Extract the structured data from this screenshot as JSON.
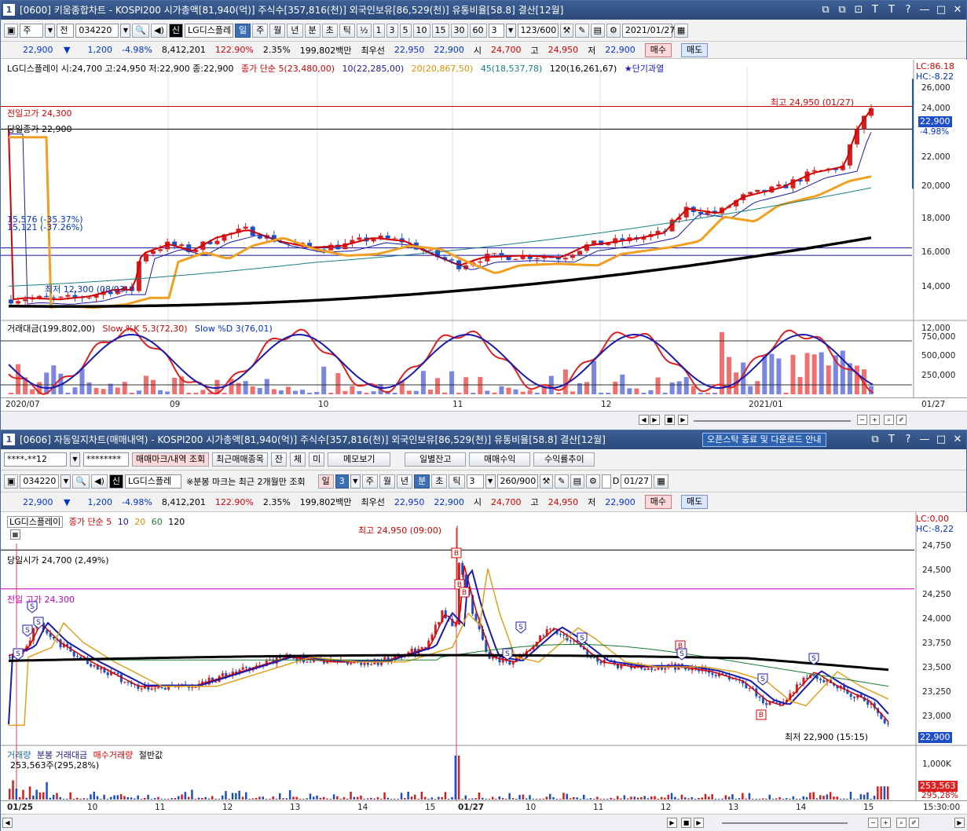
{
  "w1": {
    "num": "1",
    "title": "[0600] 키움종합차트 - KOSPI200 시가총액[81,940(억)] 주식수[357,816(천)] 외국인보유[86,529(천)] 유통비율[58.8] 결산[12월]",
    "titlebtns": [
      "⧉",
      "⧉",
      "⊡",
      "T",
      "?",
      "—",
      "□",
      "✕"
    ],
    "tb": {
      "jumeon": "주",
      "jeon": "전",
      "code": "034220",
      "shin": "신",
      "name": "LG디스플레",
      "periods": [
        "일",
        "주",
        "월",
        "년",
        "분",
        "초",
        "틱"
      ],
      "half": "½",
      "nums": [
        "1",
        "3",
        "5",
        "10",
        "15",
        "30",
        "60"
      ],
      "n3": "3",
      "count": "123/600",
      "date": "2021/01/27"
    },
    "quote": {
      "price": "22,900",
      "arrow": "▼",
      "chg": "1,200",
      "pct": "-4.98%",
      "vol": "8,412,201",
      "volpct": "122.90%",
      "turn": "2.35%",
      "amt": "199,802백만",
      "best": "최우선",
      "ask": "22,950",
      "bid": "22,900",
      "open_l": "시",
      "open": "24,700",
      "high_l": "고",
      "high": "24,950",
      "low_l": "저",
      "low": "22,900",
      "buy": "매수",
      "sell": "매도"
    },
    "legend": {
      "stock": "LG디스플레이 시:24,700 고:24,950 저:22,900 종:22,900",
      "ma": "종가 단순 5(23,480,00)",
      "ma10": "10(22,285,00)",
      "ma20": "20(20,867,50)",
      "ma45": "45(18,537,78)",
      "ma120": "120(16,261,67)",
      "star": "★단기과열"
    },
    "lc": "LC:86.18",
    "hc": "HC:-8.22",
    "prevhigh": "전일고가 24,300",
    "todayclose": "당일종가 22,900",
    "maxlbl": "최고 24,950 (01/27)",
    "minlbl": "최저 12,300 (08/03)",
    "hl1": "15,576 (-35.37%)",
    "hl2": "15,121 (-37.26%)",
    "yticks": [
      "26,000",
      "24,000",
      "22,000",
      "20,000",
      "18,000",
      "16,000",
      "14,000",
      "12,000"
    ],
    "curprice": "22,900",
    "curpct": "-4.98%",
    "sublegend": {
      "amt": "거래대금(199,802,00)",
      "k": "Slow %K 5,3(72,30)",
      "d": "Slow %D 3(76,01)"
    },
    "subticks": [
      "750,000",
      "500,000",
      "250,000"
    ],
    "xticks": [
      "2020/07",
      "09",
      "10",
      "11",
      "12",
      "2021/01"
    ],
    "xend": "01/27"
  },
  "w2": {
    "num": "1",
    "title": "[0606] 자동일지차트(매매내역) - KOSPI200 시가총액[81,940(억)] 주식수[357,816(천)] 외국인보유[86,529(천)] 유통비율[58.8] 결산[12월]",
    "notice": "오픈스탁 종료 및 다운로드 안내",
    "r1": {
      "acct": "****-**12",
      "pw": "********",
      "mark": "매매마크/내역 조회",
      "recent": "최근매매종목",
      "jan": "잔",
      "che": "체",
      "mi": "미",
      "memo": "메모보기",
      "daily": "일별잔고",
      "profit": "매매수익",
      "rate": "수익률추이"
    },
    "r2": {
      "code": "034220",
      "shin": "신",
      "name": "LG디스플레",
      "note": "※분봉 마크는 최근 2개월만 조회",
      "periods": [
        "일",
        "3",
        "주",
        "월",
        "년",
        "분",
        "초",
        "틱"
      ],
      "n3": "3",
      "count": "260/900",
      "d": "D",
      "date": "01/27"
    },
    "quote": {
      "price": "22,900",
      "arrow": "▼",
      "chg": "1,200",
      "pct": "-4.98%",
      "vol": "8,412,201",
      "volpct": "122.90%",
      "turn": "2.35%",
      "amt": "199,802백만",
      "best": "최우선",
      "ask": "22,950",
      "bid": "22,900",
      "open_l": "시",
      "open": "24,700",
      "high_l": "고",
      "high": "24,950",
      "low_l": "저",
      "low": "22,900",
      "buy": "매수",
      "sell": "매도"
    },
    "legend": {
      "name": "LG디스플레이",
      "ma": "종가 단순 5",
      "m10": "10",
      "m20": "20",
      "m60": "60",
      "m120": "120"
    },
    "lc": "LC:0,00",
    "hc": "HC:-8,22",
    "maxlbl": "최고 24,950 (09:00)",
    "openlbl": "당일시가 24,700 (2,49%)",
    "prevhigh": "전일 고가 24,300",
    "minlbl": "최저 22,900 (15:15)",
    "yticks": [
      "24,750",
      "24,500",
      "24,250",
      "24,000",
      "23,750",
      "23,500",
      "23,250",
      "23,000"
    ],
    "curprice": "22,900",
    "sublegend": {
      "vol": "거래량",
      "amt": "분봉 거래대금",
      "buyvol": "매수거래량",
      "half": "절반값",
      "vv": "253,563주(295,28%)"
    },
    "subtick": "1,000K",
    "subcur": "253,563",
    "subpct": "295,28%",
    "xticks": [
      "01/25",
      "10",
      "11",
      "12",
      "13",
      "14",
      "15",
      "01/27",
      "10",
      "11",
      "12",
      "13",
      "14",
      "15"
    ],
    "xend": "15:30:00"
  },
  "colors": {
    "up": "#d42020",
    "down": "#1f4fc8",
    "ma5": "#d40000",
    "ma10": "#1a1aa0",
    "ma20": "#f0a020",
    "ma45": "#1a8080",
    "ma120": "#000000"
  }
}
